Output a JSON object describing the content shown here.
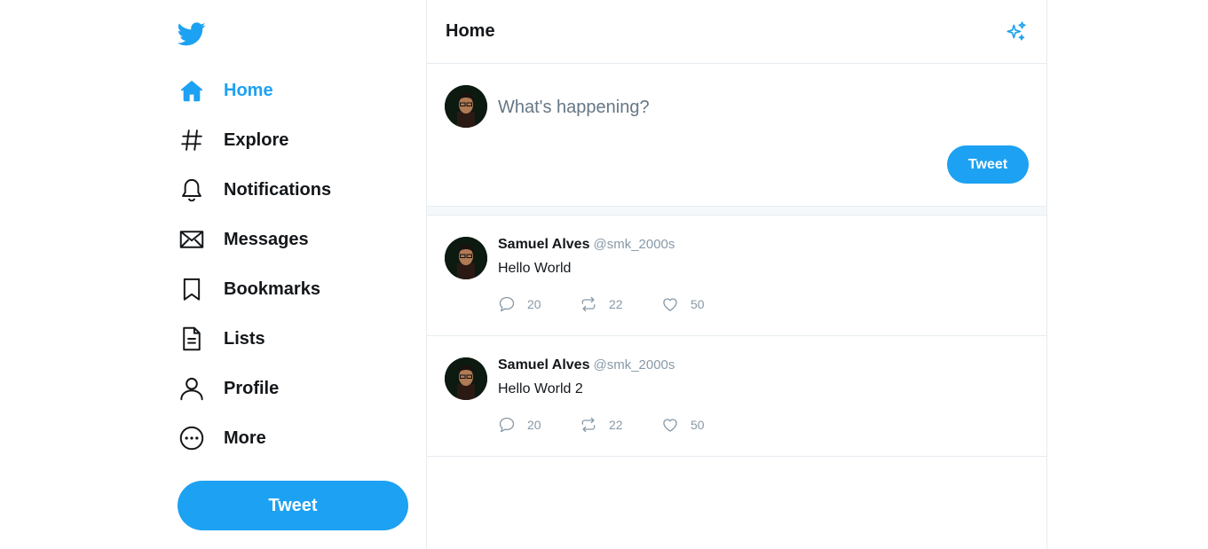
{
  "sidebar": {
    "logo_icon": "twitter-bird-icon",
    "items": [
      {
        "label": "Home",
        "icon": "home-icon",
        "active": true
      },
      {
        "label": "Explore",
        "icon": "hashtag-icon"
      },
      {
        "label": "Notifications",
        "icon": "bell-icon"
      },
      {
        "label": "Messages",
        "icon": "envelope-icon"
      },
      {
        "label": "Bookmarks",
        "icon": "bookmark-icon"
      },
      {
        "label": "Lists",
        "icon": "list-document-icon"
      },
      {
        "label": "Profile",
        "icon": "user-icon"
      },
      {
        "label": "More",
        "icon": "more-circle-icon"
      }
    ],
    "tweet_button_label": "Tweet"
  },
  "main": {
    "title": "Home",
    "top_tweets_icon": "sparkle-icon"
  },
  "composer": {
    "placeholder": "What's happening?",
    "tweet_button_label": "Tweet"
  },
  "tweets": [
    {
      "name": "Samuel Alves",
      "handle": "@smk_2000s",
      "text": "Hello World",
      "replies": "20",
      "retweets": "22",
      "likes": "50"
    },
    {
      "name": "Samuel Alves",
      "handle": "@smk_2000s",
      "text": "Hello World 2",
      "replies": "20",
      "retweets": "22",
      "likes": "50"
    }
  ],
  "colors": {
    "accent": "#1da1f2",
    "text": "#14171a",
    "muted": "#8899a6",
    "border": "#e6ecf0"
  }
}
